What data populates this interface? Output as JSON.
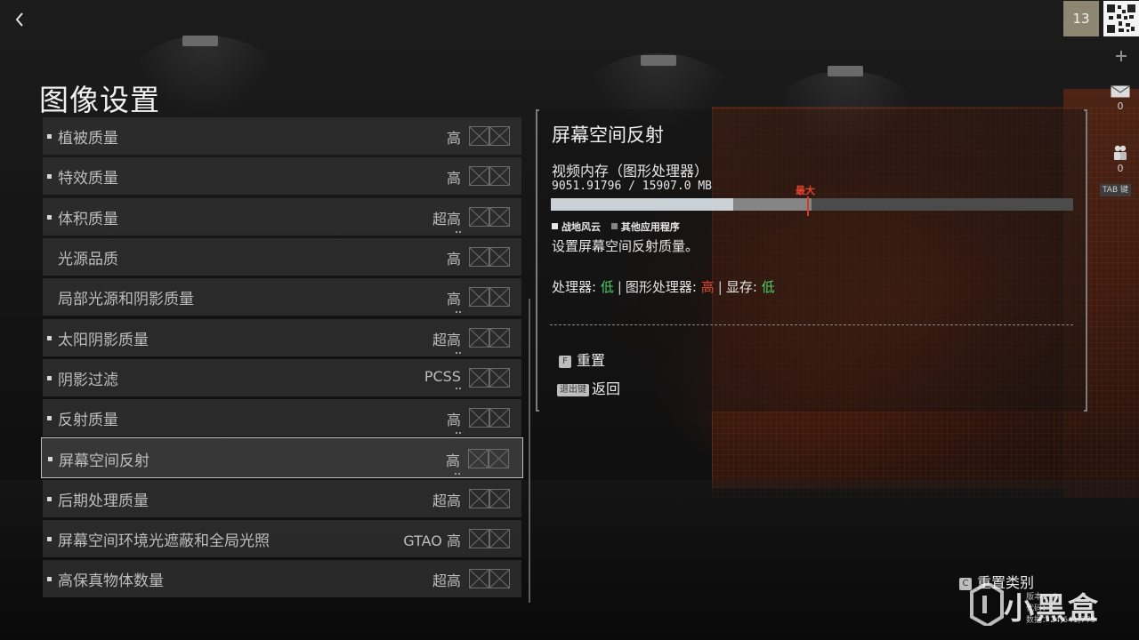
{
  "header": {
    "back_icon": "chevron-left-icon",
    "level": "13",
    "qr_icon": "qr-code-icon"
  },
  "side_rail": {
    "add_icon": "plus-icon",
    "mail_icon": "mail-icon",
    "mail_count": "0",
    "squad_icon": "squad-icon",
    "squad_count": "0",
    "tab_key": "TAB 键"
  },
  "page": {
    "title": "图像设置"
  },
  "settings": [
    {
      "label": "植被质量",
      "value": "高",
      "bullet": true,
      "dots": false
    },
    {
      "label": "特效质量",
      "value": "高",
      "bullet": true,
      "dots": false
    },
    {
      "label": "体积质量",
      "value": "超高",
      "bullet": true,
      "dots": true
    },
    {
      "label": "光源品质",
      "value": "高",
      "bullet": false,
      "dots": false
    },
    {
      "label": "局部光源和阴影质量",
      "value": "高",
      "bullet": false,
      "dots": true
    },
    {
      "label": "太阳阴影质量",
      "value": "超高",
      "bullet": true,
      "dots": true
    },
    {
      "label": "阴影过滤",
      "value": "PCSS",
      "bullet": true,
      "dots": true
    },
    {
      "label": "反射质量",
      "value": "高",
      "bullet": true,
      "dots": true
    },
    {
      "label": "屏幕空间反射",
      "value": "高",
      "bullet": true,
      "dots": true,
      "selected": true
    },
    {
      "label": "后期处理质量",
      "value": "超高",
      "bullet": true,
      "dots": false
    },
    {
      "label": "屏幕空间环境光遮蔽和全局光照",
      "value": "GTAO 高",
      "bullet": true,
      "dots": false
    },
    {
      "label": "高保真物体数量",
      "value": "超高",
      "bullet": true,
      "dots": false
    }
  ],
  "detail": {
    "title": "屏幕空间反射",
    "vram_label": "视频内存（图形处理器）",
    "vram_value": "9051.91796 / 15907.0 MB",
    "vram_game_fraction": 0.35,
    "vram_other_fraction": 0.5,
    "vram_max_fraction": 0.49,
    "max_label": "最大",
    "legend_game": "战地风云",
    "legend_other": "其他应用程序",
    "description": "设置屏幕空间反射质量。",
    "impact": {
      "cpu_label": "处理器:",
      "cpu_value": "低",
      "gpu_label": "图形处理器:",
      "gpu_value": "高",
      "vram_label": "显存:",
      "vram_value": "低"
    },
    "reset_key": "F",
    "reset_label": "重置",
    "back_key": "退出键",
    "back_label": "返回"
  },
  "footer": {
    "reset_category_key": "C",
    "reset_category_label": "重置类别",
    "build_line1": "版本：          0",
    "build_line2": "代码：",
    "build_line3": "数据：24,641,779",
    "watermark": "小黑盒"
  },
  "colors": {
    "accent_red": "#e0452f",
    "accent_green": "#4ed36b",
    "level_badge": "#8d8670"
  }
}
